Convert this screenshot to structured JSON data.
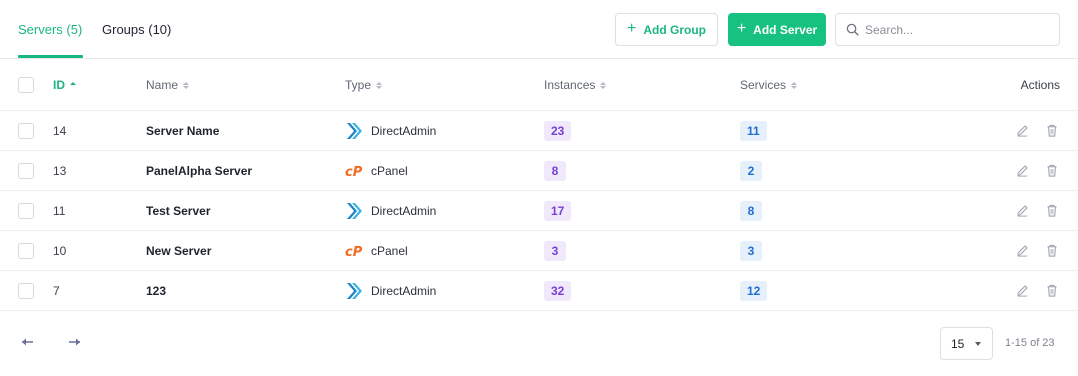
{
  "tabs": [
    {
      "label": "Servers (5)"
    },
    {
      "label": "Groups (10)"
    }
  ],
  "toolbar": {
    "add_group_label": "Add Group",
    "add_server_label": "Add Server",
    "search_placeholder": "Search..."
  },
  "table": {
    "headers": {
      "id": "ID",
      "name": "Name",
      "type": "Type",
      "instances": "Instances",
      "services": "Services",
      "actions": "Actions"
    },
    "sorted_column": "id",
    "rows": [
      {
        "id": "14",
        "name": "Server Name",
        "type": "DirectAdmin",
        "instances": "23",
        "services": "11"
      },
      {
        "id": "13",
        "name": "PanelAlpha Server",
        "type": "cPanel",
        "instances": "8",
        "services": "2"
      },
      {
        "id": "11",
        "name": "Test Server",
        "type": "DirectAdmin",
        "instances": "17",
        "services": "8"
      },
      {
        "id": "10",
        "name": "New Server",
        "type": "cPanel",
        "instances": "3",
        "services": "3"
      },
      {
        "id": "7",
        "name": "123",
        "type": "DirectAdmin",
        "instances": "32",
        "services": "12"
      }
    ]
  },
  "pagination": {
    "per_page": "15",
    "range": "1-15 of 23"
  },
  "colors": {
    "accent": "#1ab680",
    "primary_button": "#17c17f",
    "instances_badge": "#7b3fd1",
    "services_badge": "#1f6fd1",
    "directadmin_icon": "#2a9fd6",
    "cpanel_icon": "#f26b21"
  },
  "icons": {
    "directadmin": "directadmin-logo-icon",
    "cpanel": "cpanel-logo-icon",
    "edit": "pencil-icon",
    "delete": "trash-icon",
    "search": "search-icon",
    "prev": "arrow-left-icon",
    "next": "arrow-right-icon"
  }
}
